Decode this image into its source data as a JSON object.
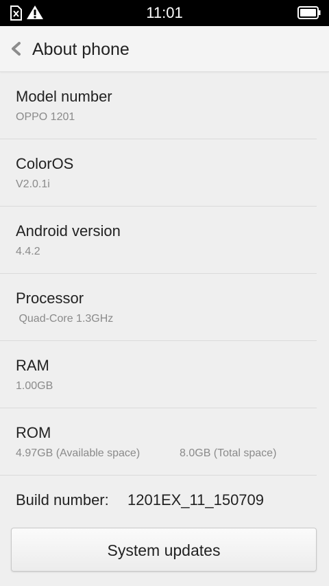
{
  "status_bar": {
    "time": "11:01",
    "icons": [
      "sim-missing-icon",
      "warning-icon",
      "battery-icon"
    ]
  },
  "action_bar": {
    "back_icon": "chevron-left-icon",
    "title": "About phone"
  },
  "items": [
    {
      "label": "Model number",
      "value": "OPPO 1201"
    },
    {
      "label": "ColorOS",
      "value": "V2.0.1i"
    },
    {
      "label": "Android version",
      "value": "4.4.2"
    },
    {
      "label": "Processor",
      "value": " Quad-Core 1.3GHz"
    },
    {
      "label": "RAM",
      "value": "1.00GB"
    },
    {
      "label": "ROM",
      "value": "4.97GB (Available space)",
      "value2": "8.0GB (Total space)"
    },
    {
      "label": "Build number:",
      "inline_value": "1201EX_11_150709"
    }
  ],
  "footer": {
    "button_label": "System updates"
  },
  "colors": {
    "background": "#efefef",
    "status_bar": "#000000",
    "primary_text": "#222222",
    "secondary_text": "#8a8a8a"
  }
}
